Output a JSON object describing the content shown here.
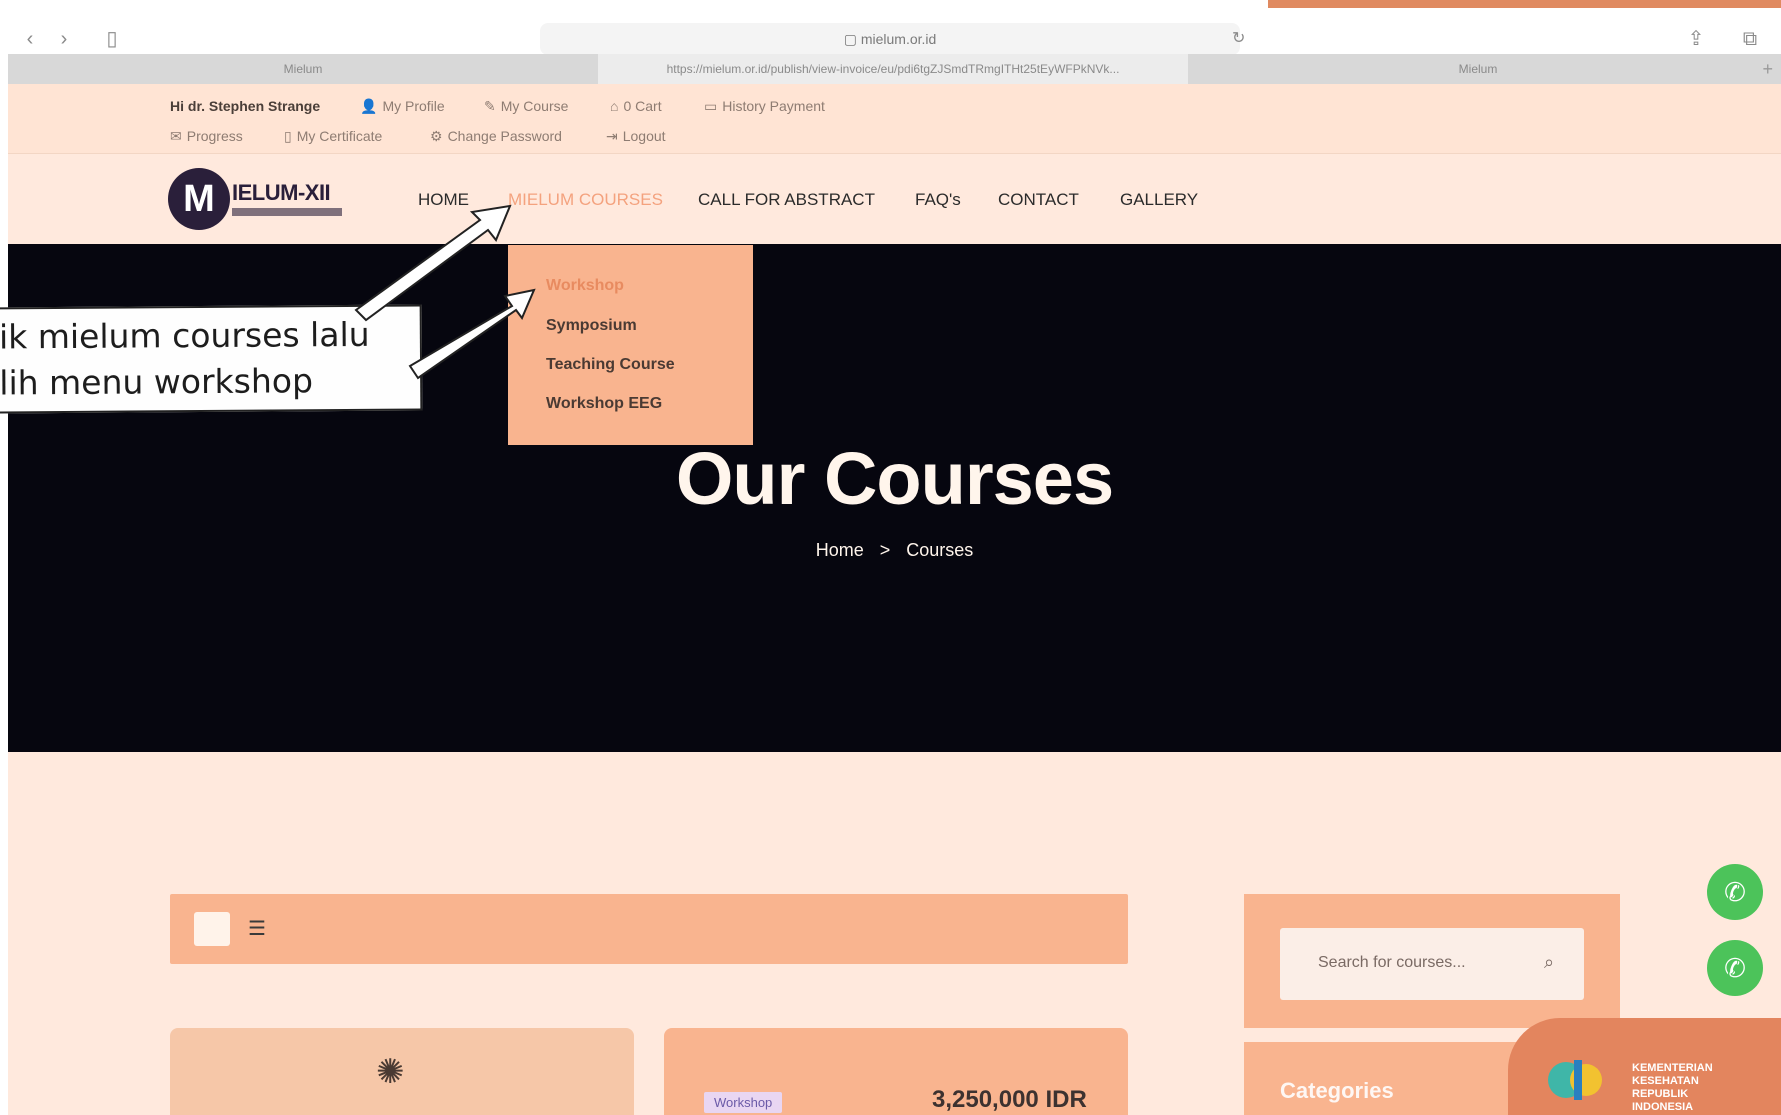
{
  "browser": {
    "address": "▢ mielum.or.id",
    "tabs": [
      {
        "label": "Mielum"
      },
      {
        "label": "https://mielum.or.id/publish/view-invoice/eu/pdi6tgZJSmdTRmgITHt25tEyWFPkNVk..."
      },
      {
        "label": "Mielum"
      }
    ],
    "plus": "+"
  },
  "userbar": {
    "greeting": "Hi dr. Stephen Strange",
    "links": [
      "My Profile",
      "My Course",
      "0 Cart",
      "History Payment",
      "Progress",
      "My Certificate",
      "Change Password",
      "Logout"
    ]
  },
  "logo": {
    "letter": "M",
    "text": "IELUM-XII"
  },
  "nav": [
    "HOME",
    "MIELUM COURSES",
    "CALL FOR ABSTRACT",
    "FAQ's",
    "CONTACT",
    "GALLERY"
  ],
  "dropdown": [
    "Workshop",
    "Symposium",
    "Teaching Course",
    "Workshop EEG"
  ],
  "hero": {
    "title": "Our Courses",
    "breadcrumb_home": "Home",
    "breadcrumb_sep": ">",
    "breadcrumb_current": "Courses"
  },
  "annotation": {
    "line1": "lik mielum courses lalu",
    "line2": "ilih menu workshop"
  },
  "search": {
    "placeholder": "Search for courses..."
  },
  "sidebar": {
    "categories_title": "Categories"
  },
  "course": {
    "badge": "Workshop",
    "price": "3,250,000 IDR"
  },
  "kemenkes": {
    "line1": "KEMENTERIAN",
    "line2": "KESEHATAN",
    "line3": "REPUBLIK",
    "line4": "INDONESIA"
  }
}
